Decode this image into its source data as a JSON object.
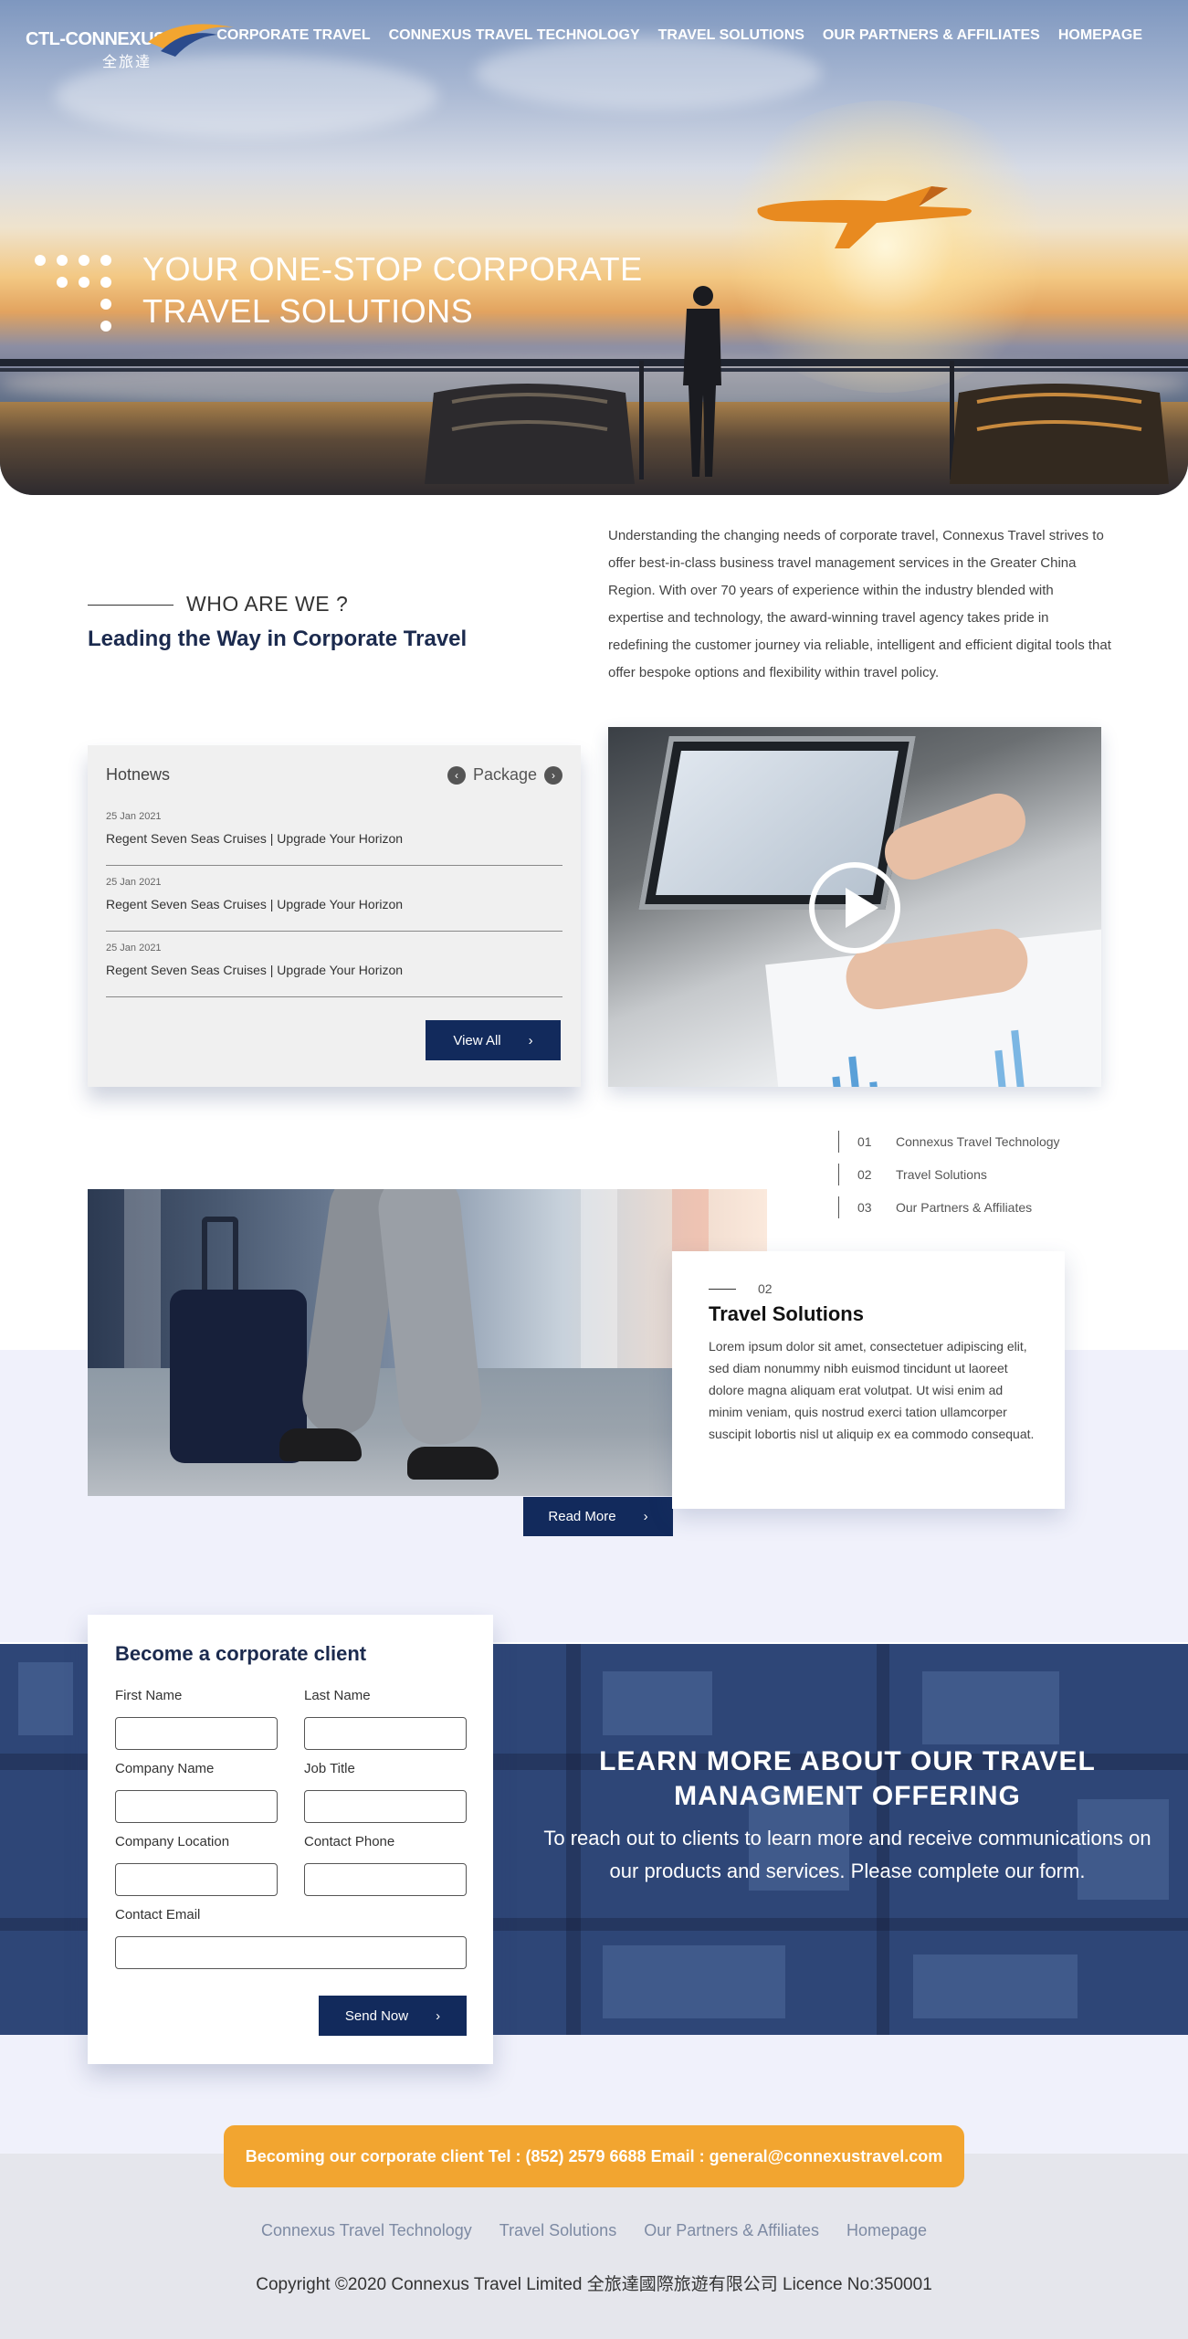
{
  "brand": {
    "logo_text": "CTL-CONNEXUS",
    "logo_cn": "全旅達",
    "accent": "#f2a530",
    "navy": "#122a5c"
  },
  "nav": {
    "items": [
      {
        "label": "CORPORATE TRAVEL"
      },
      {
        "label": "CONNEXUS TRAVEL TECHNOLOGY"
      },
      {
        "label": "TRAVEL SOLUTIONS"
      },
      {
        "label": "OUR PARTNERS & AFFILIATES"
      },
      {
        "label": "HOMEPAGE"
      }
    ]
  },
  "hero": {
    "title_line1": "YOUR ONE-STOP CORPORATE",
    "title_line2": "TRAVEL SOLUTIONS"
  },
  "about": {
    "label": "WHO ARE WE ?",
    "heading": "Leading the Way in Corporate Travel",
    "text": "Understanding the changing needs of corporate travel, Connexus Travel strives to offer best-in-class business travel management services in the Greater China Region. With over 70 years of experience within the industry blended with expertise and technology, the award-winning travel agency takes pride in redefining the customer journey via reliable, intelligent and efficient digital tools that offer bespoke options and flexibility within travel policy."
  },
  "news": {
    "title": "Hotnews",
    "package_label": "Package",
    "prev_icon": "chevron-left-icon",
    "next_icon": "chevron-right-icon",
    "items": [
      {
        "date": "25 Jan 2021",
        "headline": "Regent Seven Seas Cruises | Upgrade Your Horizon"
      },
      {
        "date": "25 Jan 2021",
        "headline": "Regent Seven Seas Cruises | Upgrade Your Horizon"
      },
      {
        "date": "25 Jan 2021",
        "headline": "Regent Seven Seas Cruises | Upgrade Your Horizon"
      }
    ],
    "view_all": "View All"
  },
  "steps": [
    {
      "num": "01",
      "label": "Connexus Travel Technology"
    },
    {
      "num": "02",
      "label": "Travel Solutions"
    },
    {
      "num": "03",
      "label": "Our Partners & Affiliates"
    }
  ],
  "solution": {
    "num": "02",
    "title": "Travel Solutions",
    "body": "Lorem ipsum dolor sit amet, consectetuer adipiscing elit, sed diam nonummy nibh euismod tincidunt ut laoreet dolore magna aliquam erat volutpat. Ut wisi enim ad minim veniam, quis nostrud exerci tation ullamcorper suscipit lobortis nisl ut aliquip ex ea commodo consequat.",
    "read_more": "Read More"
  },
  "form": {
    "title": "Become a corporate client",
    "first_name": "First Name",
    "last_name": "Last Name",
    "company_name": "Company Name",
    "job_title": "Job Title",
    "company_location": "Company Location",
    "contact_phone": "Contact Phone",
    "contact_email": "Contact Email",
    "submit": "Send Now"
  },
  "cta": {
    "title": "LEARN MORE ABOUT OUR TRAVEL MANAGMENT OFFERING",
    "text": "To reach out to clients to learn more and receive communications on our products and services. Please complete our form."
  },
  "footer": {
    "contact": "Becoming our corporate client Tel : (852) 2579 6688 Email : general@connexustravel.com",
    "links": [
      {
        "label": "Connexus Travel Technology"
      },
      {
        "label": "Travel Solutions"
      },
      {
        "label": "Our Partners & Affiliates"
      },
      {
        "label": "Homepage"
      }
    ],
    "copyright": "Copyright ©2020 Connexus Travel Limited 全旅達國際旅遊有限公司 Licence No:350001"
  }
}
